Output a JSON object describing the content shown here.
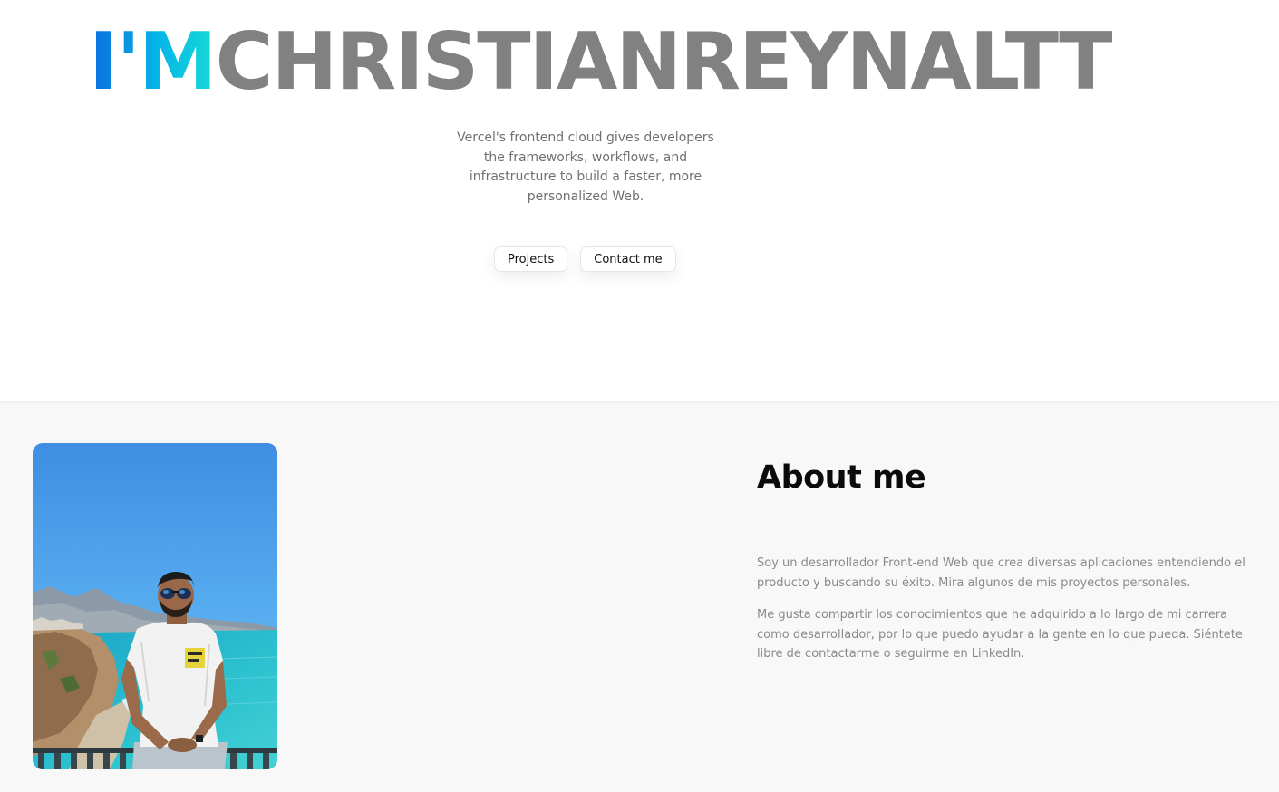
{
  "hero": {
    "title_prefix": "I'M",
    "title_name": "CHRISTIANREYNALTT",
    "description": "Vercel's frontend cloud gives developers the frameworks, workflows, and infrastructure to build a faster, more personalized Web.",
    "buttons": {
      "projects": "Projects",
      "contact": "Contact me"
    },
    "colors": {
      "title_gradient_start": "#0a6ee0",
      "title_gradient_end": "#19d9d6",
      "title_name": "#818181"
    }
  },
  "about": {
    "title": "About me",
    "paragraphs": [
      "Soy un desarrollador Front-end Web que crea diversas aplicaciones entendiendo el producto y buscando su éxito. Mira algunos de mis proyectos personales.",
      "Me gusta compartir los conocimientos que he adquirido a lo largo de mi carrera como desarrollador, por lo que puedo ayudar a la gente en lo que pueda. Siéntete libre de contactarme o seguirme en LinkedIn."
    ],
    "photo_icon": "profile-photo"
  }
}
